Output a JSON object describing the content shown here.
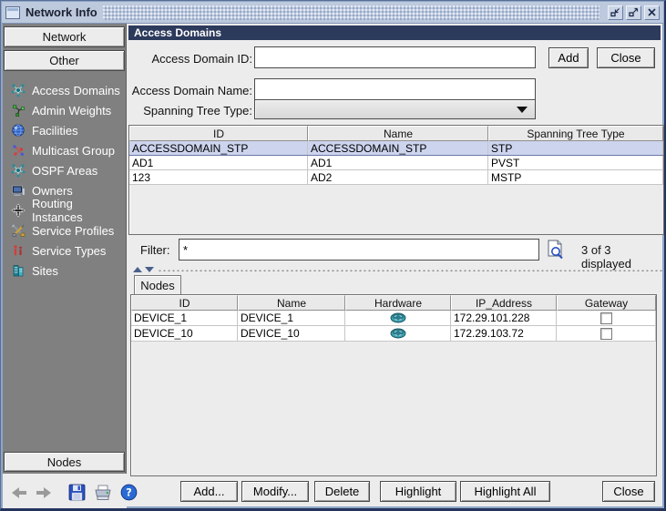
{
  "window": {
    "title": "Network Info",
    "controls": {
      "minimize": "minimize",
      "maximize": "maximize",
      "close": "close"
    }
  },
  "sidebar": {
    "top_buttons": [
      {
        "label": "Network"
      },
      {
        "label": "Other"
      }
    ],
    "items": [
      {
        "label": "Access Domains",
        "icon": "access-domains-icon"
      },
      {
        "label": "Admin Weights",
        "icon": "admin-weights-icon"
      },
      {
        "label": "Facilities",
        "icon": "globe-icon"
      },
      {
        "label": "Multicast Group",
        "icon": "multicast-icon"
      },
      {
        "label": "OSPF Areas",
        "icon": "ospf-areas-icon"
      },
      {
        "label": "Owners",
        "icon": "monitor-icon"
      },
      {
        "label": "Routing Instances",
        "icon": "routing-icon"
      },
      {
        "label": "Service Profiles",
        "icon": "tools-icon"
      },
      {
        "label": "Service Types",
        "icon": "service-types-icon"
      },
      {
        "label": "Sites",
        "icon": "sites-icon"
      }
    ],
    "bottom_button": {
      "label": "Nodes"
    },
    "toolbar_icons": [
      "back-arrow",
      "forward-arrow",
      "save",
      "print",
      "help"
    ]
  },
  "main": {
    "header": "Access Domains",
    "form": {
      "fields": [
        {
          "label": "Access Domain ID:",
          "value": ""
        },
        {
          "label": "Access Domain Name:",
          "value": ""
        },
        {
          "label": "Spanning Tree Type:",
          "value": ""
        }
      ],
      "add_label": "Add",
      "close_label": "Close"
    },
    "domains_table": {
      "columns": [
        "ID",
        "Name",
        "Spanning Tree Type"
      ],
      "rows": [
        {
          "cells": [
            "ACCESSDOMAIN_STP",
            "ACCESSDOMAIN_STP",
            "STP"
          ],
          "selected": true
        },
        {
          "cells": [
            "AD1",
            "AD1",
            "PVST"
          ],
          "selected": false
        },
        {
          "cells": [
            "123",
            "AD2",
            "MSTP"
          ],
          "selected": false
        }
      ]
    },
    "filter": {
      "label": "Filter:",
      "value": "*",
      "status": "3 of 3 displayed"
    },
    "nodes_panel": {
      "tab_label": "Nodes",
      "columns": [
        "ID",
        "Name",
        "Hardware",
        "IP_Address",
        "Gateway"
      ],
      "rows": [
        {
          "id": "DEVICE_1",
          "name": "DEVICE_1",
          "hardware": "router-icon",
          "ip": "172.29.101.228",
          "gateway_checked": false
        },
        {
          "id": "DEVICE_10",
          "name": "DEVICE_10",
          "hardware": "router-icon",
          "ip": "172.29.103.72",
          "gateway_checked": false
        }
      ]
    },
    "bottom_buttons": [
      {
        "label": "Add..."
      },
      {
        "label": "Modify..."
      },
      {
        "label": "Delete"
      },
      {
        "label": "Highlight"
      },
      {
        "label": "Highlight All"
      },
      {
        "label": "Close"
      }
    ]
  },
  "colors": {
    "header_bg": "#2c3a5c",
    "sidebar_bg": "#808080",
    "selected_row_bg": "#cdd4ee",
    "titlebar_bg": "#bdc9dd",
    "accent_teal": "#2e8b9a"
  }
}
